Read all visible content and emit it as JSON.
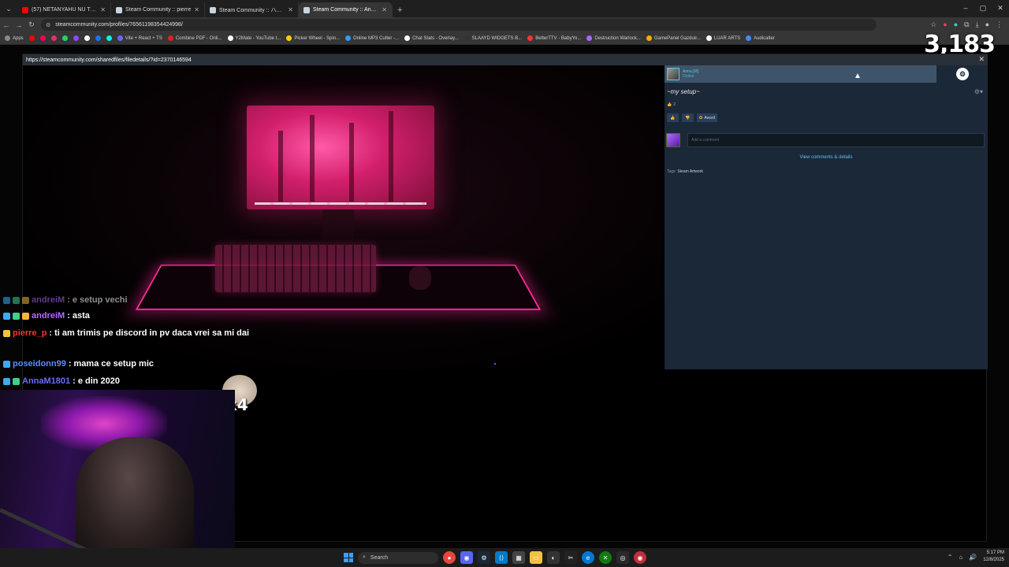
{
  "browser": {
    "tabs": [
      {
        "title": "(57) NETANYAHU NU TRE SA V...",
        "color": "#ff0000"
      },
      {
        "title": "Steam Community :: pierre",
        "color": "#c7d5e0"
      },
      {
        "title": "Steam Community :: ハイマツ-ヱ...",
        "color": "#c7d5e0"
      },
      {
        "title": "Steam Community :: Anna.[M]",
        "color": "#c7d5e0"
      }
    ],
    "url": "steamcommunity.com/profiles/76561198354424998/",
    "bookmarks": [
      {
        "label": "Apps",
        "color": "#888888"
      },
      {
        "label": "",
        "color": "#ff0000"
      },
      {
        "label": "",
        "color": "#ff0050"
      },
      {
        "label": "",
        "color": "#e1306c"
      },
      {
        "label": "",
        "color": "#25d366"
      },
      {
        "label": "",
        "color": "#9146ff"
      },
      {
        "label": "",
        "color": "#ffffff"
      },
      {
        "label": "",
        "color": "#1877f2"
      },
      {
        "label": "",
        "color": "#00f2ea"
      },
      {
        "label": "Vite + React + TS",
        "color": "#646cff"
      },
      {
        "label": "Combine PDF - Onli...",
        "color": "#e02020"
      },
      {
        "label": "Y2Mate - YouTube t...",
        "color": "#ffffff"
      },
      {
        "label": "Picker Wheel - Spin...",
        "color": "#ffd000"
      },
      {
        "label": "Online MP3 Cutter -...",
        "color": "#3399ff"
      },
      {
        "label": "Chat Stats - Overlay...",
        "color": "#ffffff"
      },
      {
        "label": "SLAAYD WIDGETS B...",
        "color": "#333333"
      },
      {
        "label": "BetterTTV - BabyYo...",
        "color": "#ff3333"
      },
      {
        "label": "Destruction Warlock...",
        "color": "#aa66ff"
      },
      {
        "label": "GamePanel Gazduir...",
        "color": "#ffaa00"
      },
      {
        "label": "LUAR ARTS",
        "color": "#ffffff"
      },
      {
        "label": "Audicalter",
        "color": "#4488ff"
      }
    ]
  },
  "viewer_count": "3,183",
  "overlay": {
    "url": "https://steamcommunity.com/sharedfiles/filedetails/?id=2370146594",
    "user_name": "Anna.[M]",
    "user_status": "Online",
    "artwork_title": "~my setup~",
    "rating_count": "2",
    "award_label": "Award",
    "comment_placeholder": "Add a comment",
    "view_comments": "View comments & details",
    "tags_label": "Tags:",
    "tags_value": "Steam Artwork"
  },
  "chat": [
    {
      "user": "andreiM",
      "user_color": "#b36bff",
      "msg": "e setup vechi",
      "faded": true
    },
    {
      "user": "andreiM",
      "user_color": "#b36bff",
      "msg": "asta",
      "faded": false
    },
    {
      "user": "pierre_p",
      "user_color": "#ff3030",
      "msg": "ti am trimis pe discord in pv daca vrei sa mi dai",
      "faded": false
    },
    {
      "user": "poseidonn99",
      "user_color": "#5b8cff",
      "msg": "mama ce setup mic",
      "faded": false
    },
    {
      "user": "AnnaM1801",
      "user_color": "#6b6bff",
      "msg": "e din 2020",
      "faded": false
    }
  ],
  "emote_multiplier": "x4",
  "taskbar": {
    "search_label": "Search",
    "time": "5:17 PM",
    "date": "12/8/2025"
  }
}
